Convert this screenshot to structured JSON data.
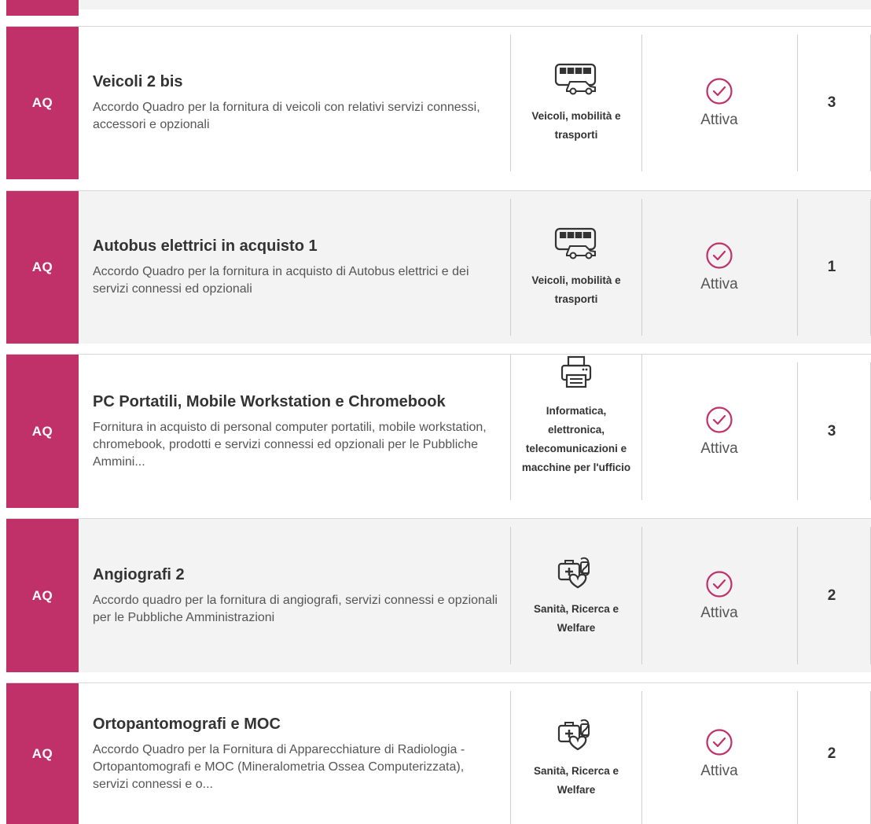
{
  "colors": {
    "tag": "#c0316a",
    "status": "#c0316a"
  },
  "cards": [
    {
      "tag": "AQ",
      "title": "Veicoli 2 bis",
      "description": "Accordo Quadro per la fornitura di veicoli con relativi servizi connessi, accessori e opzionali",
      "category_icon": "vehicles-icon",
      "category": "Veicoli, mobilità e trasporti",
      "status": "Attiva",
      "count": "3"
    },
    {
      "tag": "AQ",
      "title": "Autobus elettrici in acquisto 1",
      "description": "Accordo Quadro per la fornitura in acquisto di Autobus elettrici e dei servizi connessi ed opzionali",
      "category_icon": "vehicles-icon",
      "category": "Veicoli, mobilità e trasporti",
      "status": "Attiva",
      "count": "1"
    },
    {
      "tag": "AQ",
      "title": "PC Portatili, Mobile Workstation e Chromebook",
      "description": "Fornitura in acquisto di personal computer portatili, mobile workstation, chromebook, prodotti e servizi connessi ed opzionali per le Pubbliche Ammini...",
      "category_icon": "printer-icon",
      "category": "Informatica, elettronica, telecomunicazioni e macchine per l'ufficio",
      "status": "Attiva",
      "count": "3"
    },
    {
      "tag": "AQ",
      "title": "Angiografi 2",
      "description": "Accordo quadro per la fornitura di angiografi, servizi connessi e opzionali per le Pubbliche Amministrazioni",
      "category_icon": "health-icon",
      "category": "Sanità, Ricerca e Welfare",
      "status": "Attiva",
      "count": "2"
    },
    {
      "tag": "AQ",
      "title": "Ortopantomografi e MOC",
      "description": "Accordo Quadro per la Fornitura di Apparecchiature di Radiologia - Ortopantomografi e MOC (Mineralometria Ossea Computerizzata), servizi connessi e o...",
      "category_icon": "health-icon",
      "category": "Sanità, Ricerca e Welfare",
      "status": "Attiva",
      "count": "2"
    }
  ]
}
